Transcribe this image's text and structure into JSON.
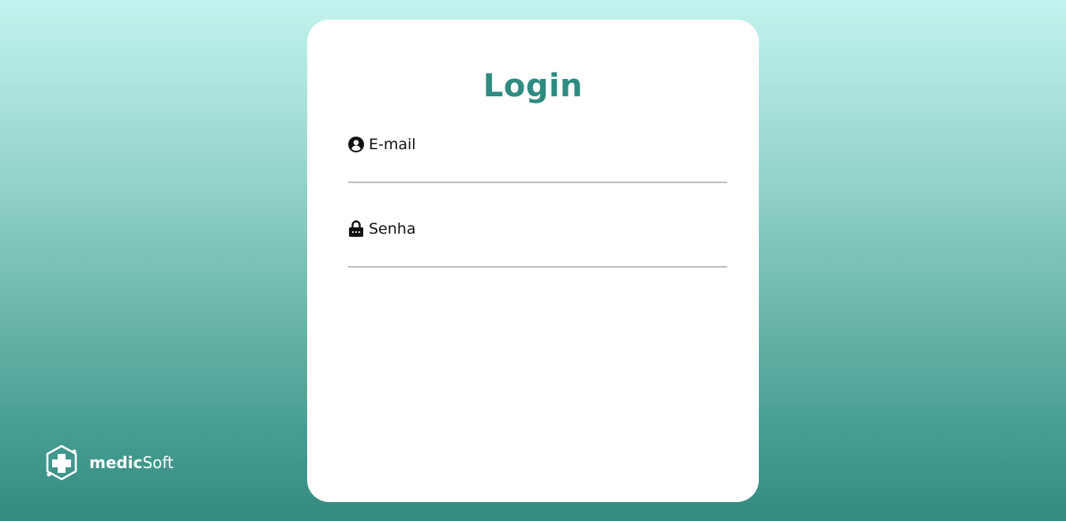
{
  "login": {
    "title": "Login",
    "email": {
      "label": "E-mail",
      "icon": "user-circle-icon",
      "value": "",
      "placeholder": ""
    },
    "password": {
      "label": "Senha",
      "icon": "lock-icon",
      "value": "",
      "placeholder": ""
    }
  },
  "brand": {
    "name_bold": "medic",
    "name_light": "Soft",
    "icon": "medical-cross-logo-icon"
  },
  "colors": {
    "accent": "#2e8b81",
    "background_top": "#c3f3ee",
    "background_bottom": "#358a80",
    "card": "#ffffff",
    "input_underline": "#bdbdbd"
  }
}
